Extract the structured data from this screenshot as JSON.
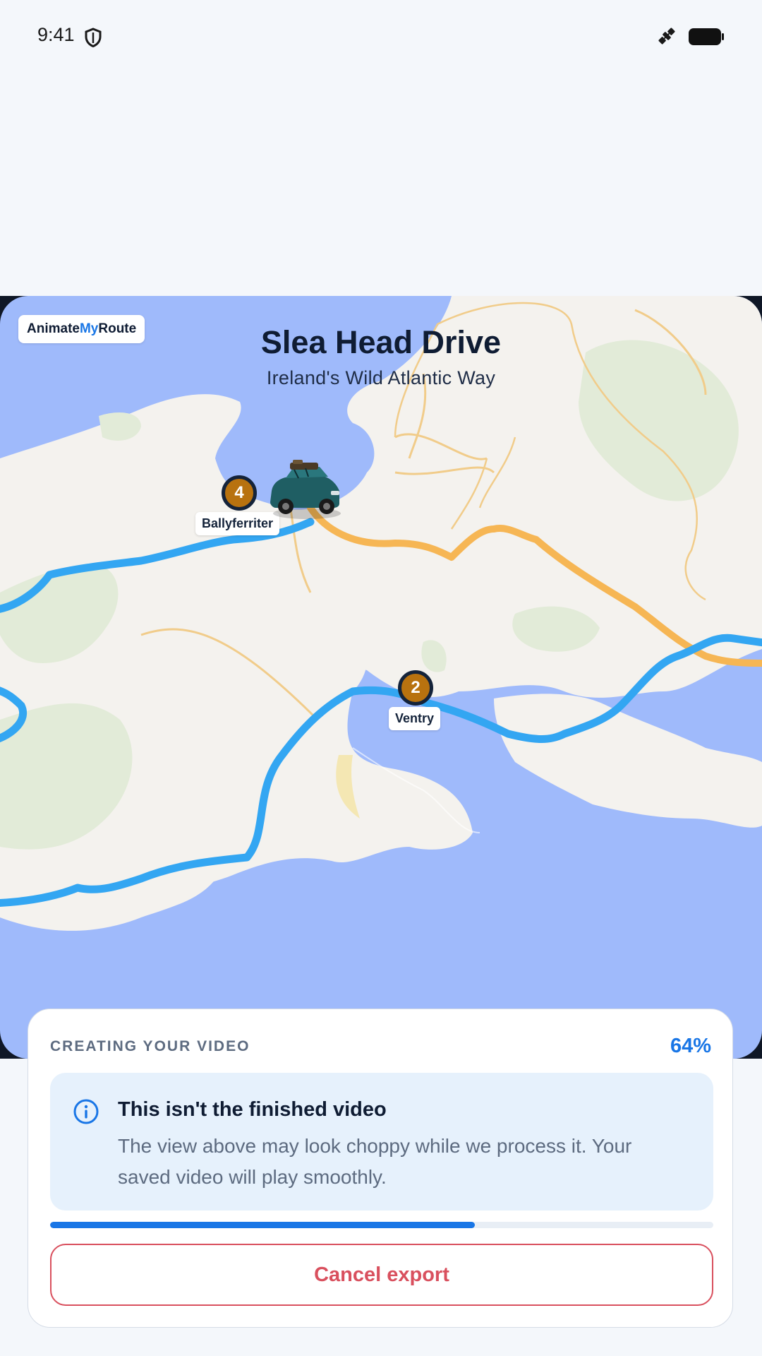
{
  "status_bar": {
    "time": "9:41"
  },
  "map": {
    "brand": {
      "part1": "Animate",
      "part2": "My",
      "part3": "Route",
      "accent_color": "#1976e6"
    },
    "title": "Slea Head Drive",
    "subtitle": "Ireland's Wild Atlantic Way",
    "markers": [
      {
        "number": "4",
        "label": "Ballyferriter"
      },
      {
        "number": "2",
        "label": "Ventry"
      }
    ],
    "colors": {
      "water": "#9fbafb",
      "land": "#f4f2ee",
      "route_done": "#33a6f2",
      "route_ahead": "#f6b654",
      "marker": "#b8720f"
    }
  },
  "export": {
    "heading": "CREATING YOUR VIDEO",
    "percent": "64%",
    "progress": 0.64,
    "notice_title": "This isn't the finished video",
    "notice_body": "The view above may look choppy while we process it. Your saved video will play smoothly.",
    "cancel_label": "Cancel export"
  }
}
